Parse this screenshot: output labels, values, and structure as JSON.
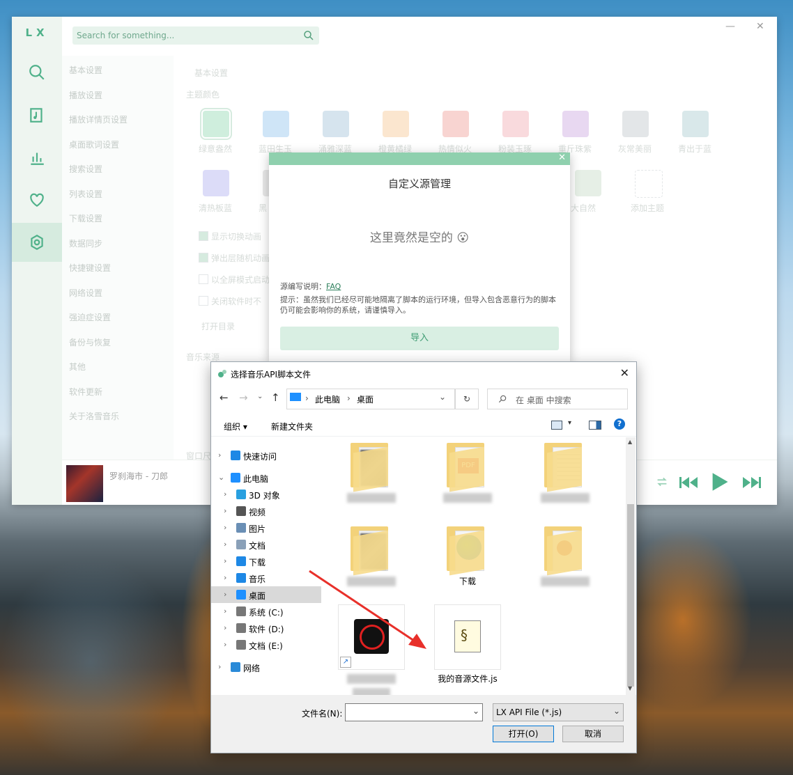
{
  "lx": {
    "logo": "LX",
    "search_placeholder": "Search for something...",
    "settings_menu": [
      "基本设置",
      "播放设置",
      "播放详情页设置",
      "桌面歌词设置",
      "搜索设置",
      "列表设置",
      "下载设置",
      "数据同步",
      "快捷键设置",
      "网络设置",
      "强迫症设置",
      "备份与恢复",
      "其他",
      "软件更新",
      "关于洛雪音乐"
    ],
    "panel_title": "基本设置",
    "theme_label": "主题颜色",
    "themes": [
      {
        "name": "绿意盎然",
        "color": "#cfeedd"
      },
      {
        "name": "蓝田生玉",
        "color": "#cfe5f7"
      },
      {
        "name": "涌雅深蓝",
        "color": "#d6e4ee"
      },
      {
        "name": "橙黄橘绿",
        "color": "#fbe6cf"
      },
      {
        "name": "热情似火",
        "color": "#f8d4d1"
      },
      {
        "name": "粉装玉琢",
        "color": "#f9dadd"
      },
      {
        "name": "重斤珠紫",
        "color": "#e8d8f1"
      },
      {
        "name": "灰常美丽",
        "color": "#e3e6e8"
      },
      {
        "name": "青出于蓝",
        "color": "#d9e8ea"
      },
      {
        "name": "清热板蓝",
        "color": "#dcdcf8"
      },
      {
        "name": "黑",
        "color": "#e7e7e7"
      },
      {
        "name": "大自然",
        "color": "#e6efe6"
      },
      {
        "name": "添加主题",
        "color": "#ffffff"
      }
    ],
    "checkbox_options": [
      "显示切换动画",
      "弹出层随机动画",
      "以全屏模式启动",
      "关闭软件时不"
    ],
    "open_btn": "打开目录",
    "music_source": "音乐来源",
    "window_label": "窗口尺",
    "player": {
      "song": "罗刹海市 - 刀郎"
    }
  },
  "source_dialog": {
    "title": "自定义源管理",
    "empty": "这里竟然是空的 😮",
    "faq_prefix": "源编写说明：",
    "faq_link": "FAQ",
    "tip": "提示：虽然我们已经尽可能地隔离了脚本的运行环境，但导入包含恶意行为的脚本仍可能会影响你的系统，请谨慎导入。",
    "import": "导入"
  },
  "file_dialog": {
    "title": "选择音乐API脚本文件",
    "path": [
      "此电脑",
      "桌面"
    ],
    "search_placeholder": "在 桌面 中搜索",
    "organize": "组织 ▾",
    "new_folder": "新建文件夹",
    "tree": [
      {
        "label": "快速访问",
        "level": 0,
        "icon": "star-icon"
      },
      {
        "label": "此电脑",
        "level": 0,
        "icon": "computer-icon"
      },
      {
        "label": "3D 对象",
        "level": 1,
        "icon": "cube-icon"
      },
      {
        "label": "视频",
        "level": 1,
        "icon": "film-icon"
      },
      {
        "label": "图片",
        "level": 1,
        "icon": "picture-icon"
      },
      {
        "label": "文档",
        "level": 1,
        "icon": "document-icon"
      },
      {
        "label": "下载",
        "level": 1,
        "icon": "download-icon"
      },
      {
        "label": "音乐",
        "level": 1,
        "icon": "music-note-icon"
      },
      {
        "label": "桌面",
        "level": 1,
        "icon": "desktop-icon"
      },
      {
        "label": "系统 (C:)",
        "level": 1,
        "icon": "drive-icon"
      },
      {
        "label": "软件 (D:)",
        "level": 1,
        "icon": "drive-icon"
      },
      {
        "label": "文档 (E:)",
        "level": 1,
        "icon": "drive-icon"
      },
      {
        "label": "网络",
        "level": 0,
        "icon": "network-icon"
      }
    ],
    "files": [
      {
        "label": "",
        "kind": "folder"
      },
      {
        "label": "",
        "kind": "folder-pdf"
      },
      {
        "label": "",
        "kind": "folder-doc"
      },
      {
        "label": "",
        "kind": "folder"
      },
      {
        "label": "下载",
        "kind": "folder-download"
      },
      {
        "label": "",
        "kind": "folder-ppt"
      },
      {
        "label": "",
        "kind": "shortcut"
      },
      {
        "label": "我的音源文件.js",
        "kind": "script"
      }
    ],
    "filename_label": "文件名(N):",
    "filetype": "LX API File (*.js)",
    "open": "打开(O)",
    "cancel": "取消"
  },
  "colors": {
    "accent": "#4fb18a",
    "annotation_arrow": "#e8302a"
  }
}
